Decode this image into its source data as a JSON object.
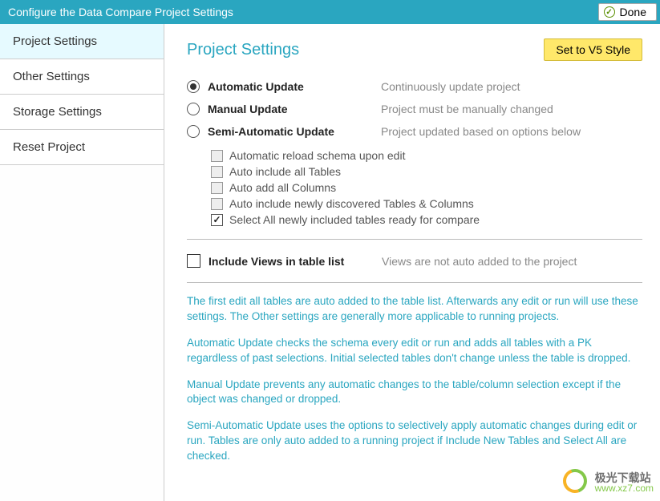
{
  "titlebar": {
    "title": "Configure the Data Compare Project Settings",
    "done_label": "Done"
  },
  "sidebar": {
    "items": [
      {
        "label": "Project Settings",
        "active": true
      },
      {
        "label": "Other Settings",
        "active": false
      },
      {
        "label": "Storage Settings",
        "active": false
      },
      {
        "label": "Reset Project",
        "active": false
      }
    ]
  },
  "main": {
    "title": "Project Settings",
    "style_button": "Set to V5 Style",
    "update_modes": [
      {
        "label": "Automatic Update",
        "desc": "Continuously update project",
        "selected": true
      },
      {
        "label": "Manual Update",
        "desc": "Project must be manually changed",
        "selected": false
      },
      {
        "label": "Semi-Automatic Update",
        "desc": "Project updated based on options below",
        "selected": false
      }
    ],
    "sub_options": [
      {
        "label": "Automatic reload schema upon edit",
        "checked": false
      },
      {
        "label": "Auto include all Tables",
        "checked": false
      },
      {
        "label": "Auto add all Columns",
        "checked": false
      },
      {
        "label": "Auto include newly discovered Tables & Columns",
        "checked": false
      },
      {
        "label": "Select All newly included tables ready for compare",
        "checked": true
      }
    ],
    "views": {
      "label": "Include Views in table list",
      "desc": "Views are not auto added to the project",
      "checked": false
    },
    "help": [
      "The first edit all tables are auto added to the table list. Afterwards any edit or run will use these settings. The Other settings are generally more applicable to running projects.",
      "Automatic Update checks the schema every edit or run and adds all tables with a PK regardless of past selections. Initial selected tables don't change unless the table is dropped.",
      "Manual Update prevents any automatic changes to the table/column selection except if the object was changed or dropped.",
      "Semi-Automatic Update uses the options to selectively apply automatic changes during edit or run. Tables are only auto added to a running project if Include New Tables and Select All are checked."
    ]
  },
  "watermark": {
    "cn": "极光下载站",
    "url": "www.xz7.com"
  }
}
